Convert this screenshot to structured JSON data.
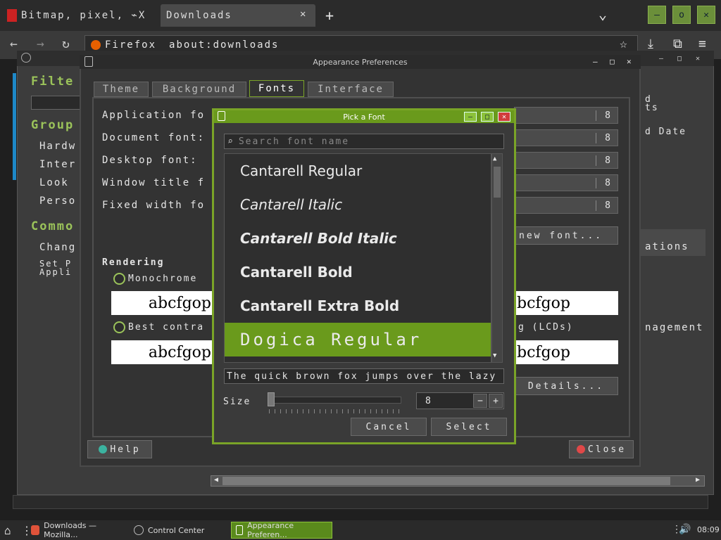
{
  "firefox": {
    "tabs": [
      {
        "label": "Bitmap, pixel, ⌁X"
      },
      {
        "label": "Downloads"
      }
    ],
    "new_tab": "+",
    "tab_list": "⌄",
    "win_controls": {
      "min": "–",
      "max": "o",
      "close": "✕"
    },
    "url_identity": "Firefox",
    "url": "about:downloads"
  },
  "control_center": {
    "sidebar": [
      "Filte",
      "Group",
      "Hardw",
      "Inter",
      "Look",
      "Perso",
      "Commo",
      "Chang",
      "Set P",
      "Appli"
    ],
    "right_snips": [
      "d",
      "ts",
      "d Date",
      "ations",
      "nagement"
    ]
  },
  "appearance": {
    "title": "Appearance Preferences",
    "tabs": [
      "Theme",
      "Background",
      "Fonts",
      "Interface"
    ],
    "font_rows": [
      {
        "label": "Application fo",
        "size": "8"
      },
      {
        "label": "Document font:",
        "size": "8"
      },
      {
        "label": "Desktop font:",
        "size": "8"
      },
      {
        "label": "Window title f",
        "size": "8"
      },
      {
        "label": "Fixed width fo",
        "size": "8"
      }
    ],
    "new_font_button": "new font...",
    "rendering_label": "Rendering",
    "monochrome_label": "Monochrome",
    "best_contrast_label": "Best contra",
    "subpixel_label": "g (LCDs)",
    "sample_text_left": "abcfgop",
    "sample_text_right": "bcfgop",
    "details_button": "Details...",
    "help_button": "Help",
    "close_button": "Close"
  },
  "font_dialog": {
    "title": "Pick a Font",
    "search_placeholder": "Search font name",
    "fonts": [
      {
        "name": "Cantarell Regular"
      },
      {
        "name": "Cantarell Italic"
      },
      {
        "name": "Cantarell Bold Italic"
      },
      {
        "name": "Cantarell Bold"
      },
      {
        "name": "Cantarell Extra Bold"
      },
      {
        "name": "Dogica Regular"
      }
    ],
    "selected_index": 5,
    "preview_text": "The quick brown fox jumps over the lazy dog",
    "size_label": "Size",
    "size_value": "8",
    "size_minus": "−",
    "size_plus": "+",
    "cancel_button": "Cancel",
    "select_button": "Select"
  },
  "taskbar": {
    "items": [
      "Downloads — Mozilla...",
      "Control Center",
      "Appearance Preferen..."
    ],
    "clock": "08:09"
  },
  "colors": {
    "accent": "#6a9a1c",
    "accent_light": "#8cc23a",
    "bg": "#333333"
  }
}
